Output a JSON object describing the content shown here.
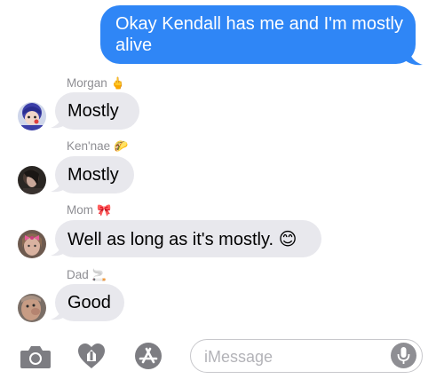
{
  "conversation": {
    "outgoing": [
      {
        "text": "Okay Kendall has me and I'm mostly alive"
      }
    ],
    "incoming": [
      {
        "sender": "Morgan",
        "sender_emoji": "🖕",
        "text": "Mostly"
      },
      {
        "sender": "Ken'nae",
        "sender_emoji": "🌮",
        "text": "Mostly"
      },
      {
        "sender": "Mom",
        "sender_emoji": "🎀",
        "text": "Well as long as it's mostly. 😊"
      },
      {
        "sender": "Dad",
        "sender_emoji": "🚬",
        "text": "Good"
      }
    ]
  },
  "composer": {
    "placeholder": "iMessage",
    "icons": [
      "camera-icon",
      "digital-touch-icon",
      "app-store-icon",
      "microphone-icon"
    ]
  },
  "colors": {
    "outgoing_bubble": "#2f86f6",
    "incoming_bubble": "#e8e8ed",
    "sender_name": "#8e8e93",
    "icon_gray": "#7d7d82"
  }
}
